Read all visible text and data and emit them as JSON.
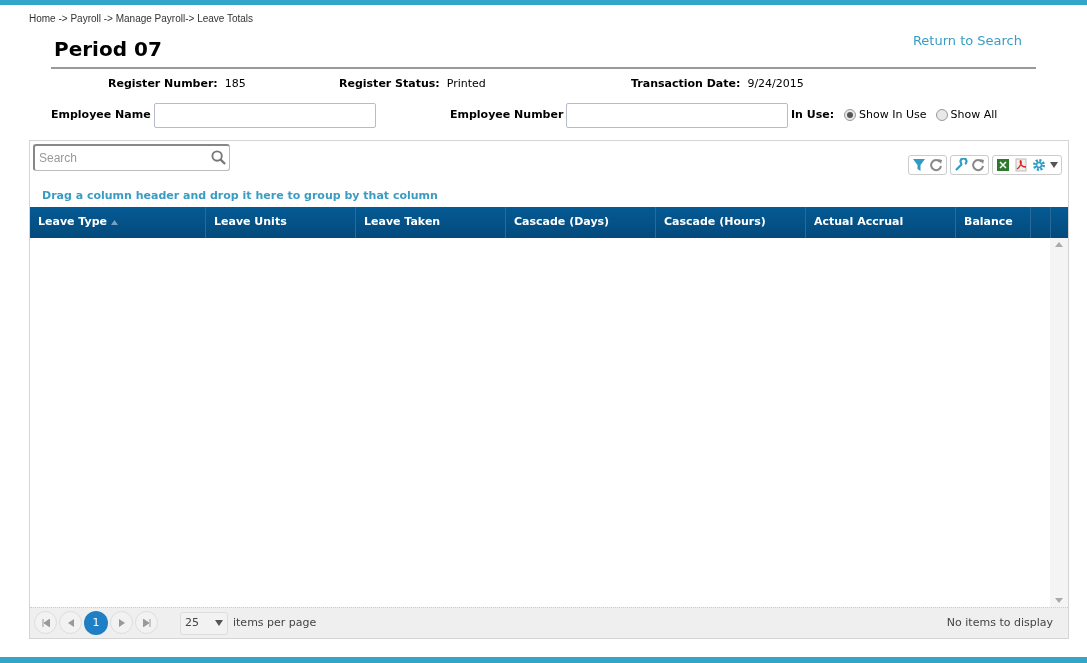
{
  "breadcrumb": "Home -> Payroll -> Manage Payroll-> Leave Totals",
  "title": "Period 07",
  "return_link": "Return to Search",
  "info": [
    {
      "label": "Register Number:",
      "value": "185"
    },
    {
      "label": "Register Status:",
      "value": "Printed"
    },
    {
      "label": "Transaction Date:",
      "value": "9/24/2015"
    }
  ],
  "filters": [
    {
      "label": "Employee Name"
    },
    {
      "label": "Employee Number"
    }
  ],
  "in_use": {
    "label": "In Use:",
    "options": [
      {
        "label": "Show In Use",
        "selected": true
      },
      {
        "label": "Show All",
        "selected": false
      }
    ]
  },
  "grid": {
    "search": {
      "placeholder": "Search"
    },
    "group_hint": "Drag a column header and drop it here to group by that column",
    "columns": [
      {
        "label": "Leave Type",
        "sorted": true
      },
      {
        "label": "Leave Units",
        "sorted": false
      },
      {
        "label": "Leave Taken",
        "sorted": false
      },
      {
        "label": "Cascade (Days)",
        "sorted": false
      },
      {
        "label": "Cascade (Hours)",
        "sorted": false
      },
      {
        "label": "Actual Accrual",
        "sorted": false
      },
      {
        "label": "Balance",
        "sorted": false
      }
    ],
    "pager": {
      "pages": [
        {
          "label": "1",
          "selected": true
        }
      ],
      "page_size": "25",
      "page_size_label": "items per page",
      "status": "No items to display"
    }
  }
}
